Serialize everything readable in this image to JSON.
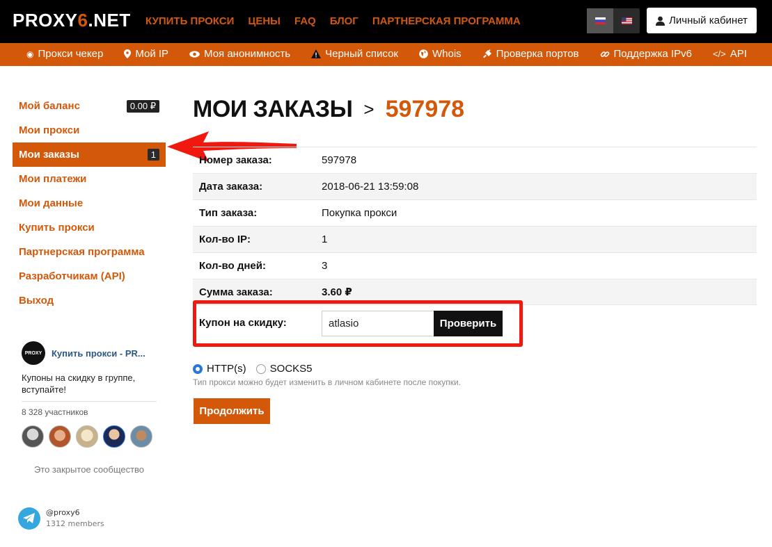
{
  "header": {
    "logo_main": "PROXY",
    "logo_six": "6",
    "logo_tail": ".NET",
    "nav": [
      "КУПИТЬ ПРОКСИ",
      "ЦЕНЫ",
      "FAQ",
      "БЛОГ",
      "ПАРТНЕРСКАЯ ПРОГРАММА"
    ],
    "languages": [
      "ru-flag-icon",
      "us-flag-icon"
    ],
    "cabinet_label": "Личный кабинет"
  },
  "subnav": [
    {
      "icon": "target-icon",
      "label": "Прокси чекер"
    },
    {
      "icon": "map-marker-icon",
      "label": "Мой IP"
    },
    {
      "icon": "eye-icon",
      "label": "Моя анонимность"
    },
    {
      "icon": "warning-icon",
      "label": "Черный список"
    },
    {
      "icon": "globe-icon",
      "label": "Whois"
    },
    {
      "icon": "plug-icon",
      "label": "Проверка портов"
    },
    {
      "icon": "link-icon",
      "label": "Поддержка IPv6"
    },
    {
      "icon": "code-icon",
      "label": "API"
    }
  ],
  "sidebar": {
    "items": [
      {
        "label": "Мой баланс",
        "badge": "0.00 ₽"
      },
      {
        "label": "Мои прокси",
        "badge": ""
      },
      {
        "label": "Мои заказы",
        "badge": "1"
      },
      {
        "label": "Мои платежи",
        "badge": ""
      },
      {
        "label": "Мои данные",
        "badge": ""
      },
      {
        "label": "Купить прокси",
        "badge": ""
      },
      {
        "label": "Партнерская программа",
        "badge": ""
      },
      {
        "label": "Разработчикам (API)",
        "badge": ""
      },
      {
        "label": "Выход",
        "badge": ""
      }
    ],
    "active_index": 2
  },
  "vk_widget": {
    "logo_text": "PROXY",
    "title": "Купить прокси - PR...",
    "description": "Купоны на скидку в группе, вступайте!",
    "members": "8 328 участников",
    "closed_text": "Это закрытое сообщество"
  },
  "telegram": {
    "handle": "@proxy6",
    "members": "1312 members"
  },
  "page": {
    "title": "МОИ ЗАКАЗЫ",
    "separator": ">",
    "order_id": "597978"
  },
  "order": [
    {
      "label": "Номер заказа:",
      "value": "597978"
    },
    {
      "label": "Дата заказа:",
      "value": "2018-06-21 13:59:08"
    },
    {
      "label": "Тип заказа:",
      "value": "Покупка прокси"
    },
    {
      "label": "Кол-во IP:",
      "value": "1"
    },
    {
      "label": "Кол-во дней:",
      "value": "3"
    },
    {
      "label": "Сумма заказа:",
      "value": "3.60 ₽"
    }
  ],
  "coupon": {
    "label": "Купон на скидку:",
    "value": "atlasio",
    "check_button": "Проверить"
  },
  "proxy_type": {
    "options": [
      "HTTP(s)",
      "SOCKS5"
    ],
    "selected": "HTTP(s)",
    "hint": "Тип прокси можно будет изменить в личном кабинете после покупки."
  },
  "continue_button": "Продолжить",
  "colors": {
    "accent": "#d4580a",
    "highlight_red": "#f0190f",
    "topbar": "#000000"
  }
}
